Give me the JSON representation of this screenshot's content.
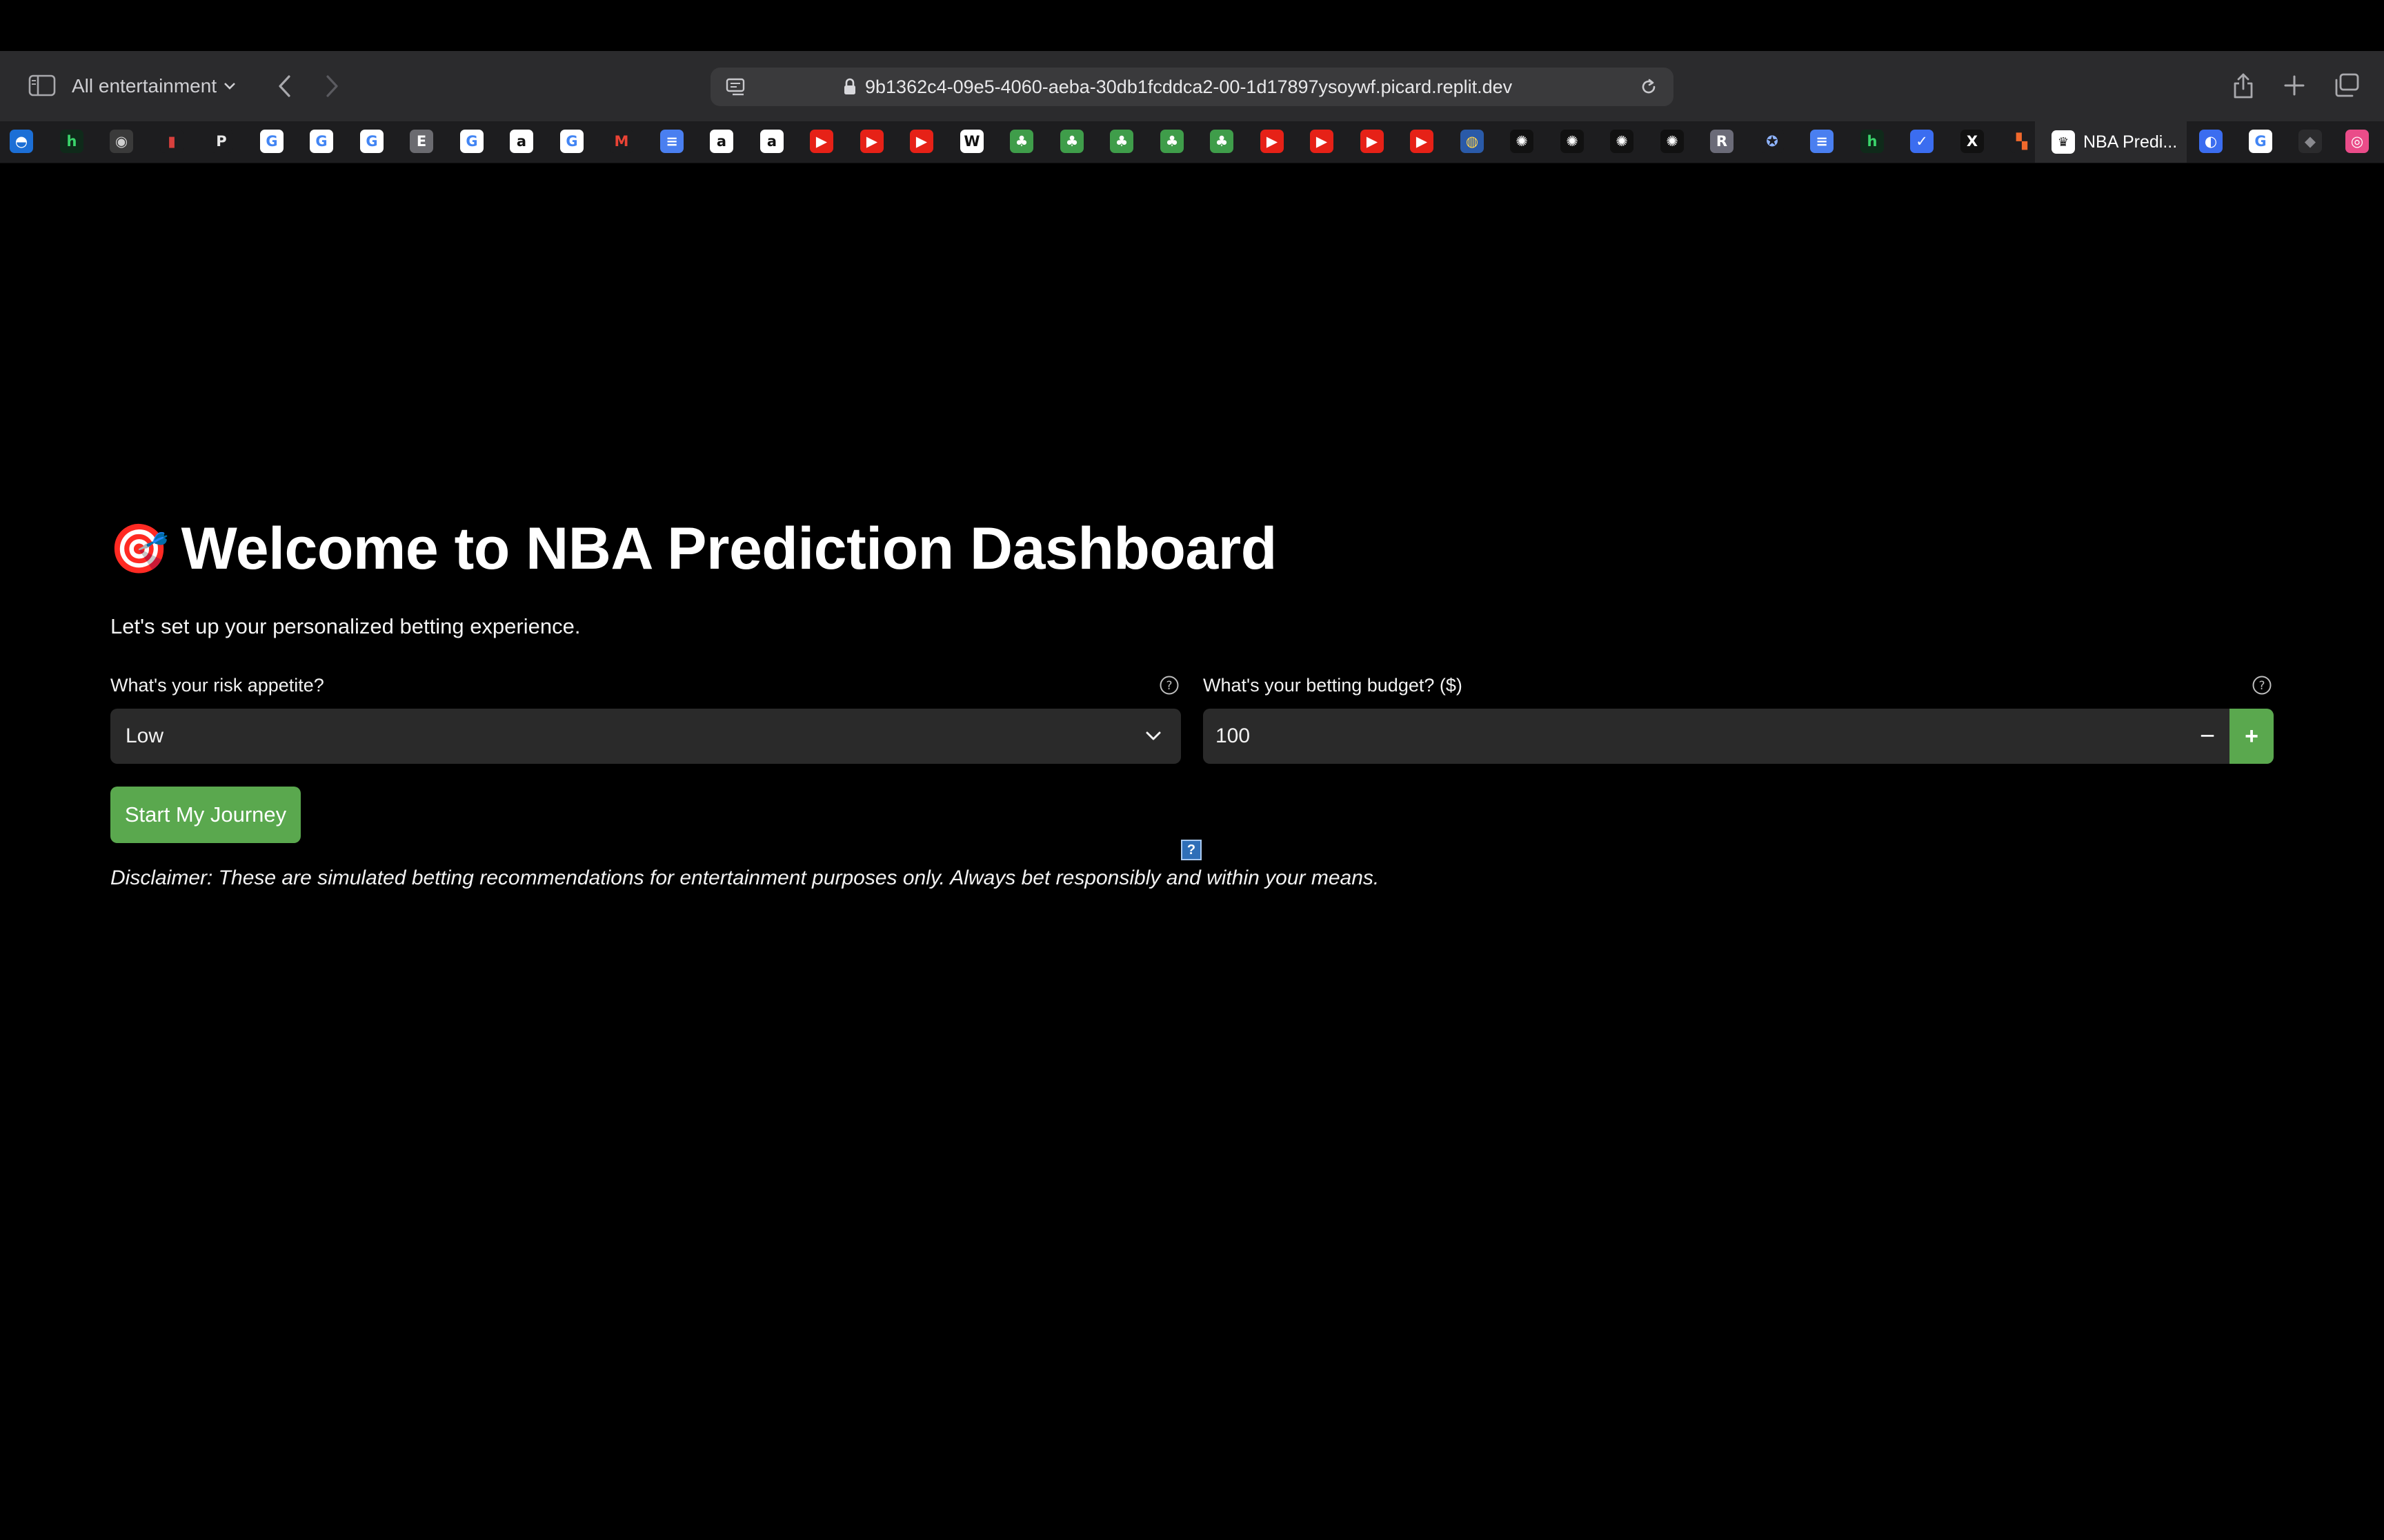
{
  "browser": {
    "tab_group_label": "All entertainment",
    "url": "9b1362c4-09e5-4060-aeba-30db1fcddca2-00-1d17897ysoywf.picard.replit.dev",
    "active_tab_title": "NBA Predi...",
    "favicons": [
      {
        "name": "app-blue-favicon",
        "glyph": "◓",
        "bg": "#1c6fd6",
        "fg": "#ffffff"
      },
      {
        "name": "h-favicon",
        "glyph": "h",
        "bg": "#0f2a1a",
        "fg": "#3ad46b"
      },
      {
        "name": "circle-logo-favicon",
        "glyph": "◉",
        "bg": "#3a3a3a",
        "fg": "#cfcfcf"
      },
      {
        "name": "nba-favicon",
        "glyph": "▮",
        "bg": "#1d1d1f",
        "fg": "#d8403d"
      },
      {
        "name": "p-favicon",
        "glyph": "P",
        "bg": "#1d1d1f",
        "fg": "#e8e8e8"
      },
      {
        "name": "google-favicon",
        "glyph": "G",
        "bg": "#ffffff",
        "fg": "#4285f4"
      },
      {
        "name": "google-favicon",
        "glyph": "G",
        "bg": "#ffffff",
        "fg": "#4285f4"
      },
      {
        "name": "google-favicon",
        "glyph": "G",
        "bg": "#ffffff",
        "fg": "#4285f4"
      },
      {
        "name": "e-favicon",
        "glyph": "E",
        "bg": "#6b6b70",
        "fg": "#ffffff"
      },
      {
        "name": "google-favicon",
        "glyph": "G",
        "bg": "#ffffff",
        "fg": "#4285f4"
      },
      {
        "name": "amazon-favicon",
        "glyph": "a",
        "bg": "#ffffff",
        "fg": "#111111"
      },
      {
        "name": "google-favicon",
        "glyph": "G",
        "bg": "#ffffff",
        "fg": "#4285f4"
      },
      {
        "name": "gmail-favicon",
        "glyph": "M",
        "bg": "#1d1d1f",
        "fg": "#ea4335"
      },
      {
        "name": "docs-favicon",
        "glyph": "≡",
        "bg": "#4a7ff0",
        "fg": "#ffffff"
      },
      {
        "name": "amazon-favicon",
        "glyph": "a",
        "bg": "#ffffff",
        "fg": "#111111"
      },
      {
        "name": "amazon-favicon",
        "glyph": "a",
        "bg": "#ffffff",
        "fg": "#111111"
      },
      {
        "name": "youtube-favicon",
        "glyph": "▶",
        "bg": "#e62117",
        "fg": "#ffffff"
      },
      {
        "name": "youtube-favicon",
        "glyph": "▶",
        "bg": "#e62117",
        "fg": "#ffffff"
      },
      {
        "name": "youtube-favicon",
        "glyph": "▶",
        "bg": "#e62117",
        "fg": "#ffffff"
      },
      {
        "name": "wikipedia-favicon",
        "glyph": "W",
        "bg": "#ffffff",
        "fg": "#111111"
      },
      {
        "name": "green-app-favicon",
        "glyph": "♣",
        "bg": "#3f9d4a",
        "fg": "#ffffff"
      },
      {
        "name": "green-app-favicon",
        "glyph": "♣",
        "bg": "#3f9d4a",
        "fg": "#ffffff"
      },
      {
        "name": "green-app-favicon",
        "glyph": "♣",
        "bg": "#3f9d4a",
        "fg": "#ffffff"
      },
      {
        "name": "green-app-favicon",
        "glyph": "♣",
        "bg": "#3f9d4a",
        "fg": "#ffffff"
      },
      {
        "name": "green-app-favicon",
        "glyph": "♣",
        "bg": "#3f9d4a",
        "fg": "#ffffff"
      },
      {
        "name": "youtube-favicon",
        "glyph": "▶",
        "bg": "#e62117",
        "fg": "#ffffff"
      },
      {
        "name": "youtube-favicon",
        "glyph": "▶",
        "bg": "#e62117",
        "fg": "#ffffff"
      },
      {
        "name": "youtube-favicon",
        "glyph": "▶",
        "bg": "#e62117",
        "fg": "#ffffff"
      },
      {
        "name": "youtube-favicon",
        "glyph": "▶",
        "bg": "#e62117",
        "fg": "#ffffff"
      },
      {
        "name": "globe-favicon",
        "glyph": "◍",
        "bg": "#2a5aa8",
        "fg": "#ffd34d"
      },
      {
        "name": "openai-favicon",
        "glyph": "✺",
        "bg": "#111111",
        "fg": "#ffffff"
      },
      {
        "name": "openai-favicon",
        "glyph": "✺",
        "bg": "#111111",
        "fg": "#ffffff"
      },
      {
        "name": "openai-favicon",
        "glyph": "✺",
        "bg": "#111111",
        "fg": "#ffffff"
      },
      {
        "name": "openai-favicon",
        "glyph": "✺",
        "bg": "#111111",
        "fg": "#ffffff"
      },
      {
        "name": "r-favicon",
        "glyph": "R",
        "bg": "#6b6b78",
        "fg": "#ffffff"
      },
      {
        "name": "shield-favicon",
        "glyph": "✪",
        "bg": "#1d1d1f",
        "fg": "#8fb4ff"
      },
      {
        "name": "docs-favicon",
        "glyph": "≡",
        "bg": "#4a7ff0",
        "fg": "#ffffff"
      },
      {
        "name": "h-favicon",
        "glyph": "h",
        "bg": "#0f2a1a",
        "fg": "#3ad46b"
      },
      {
        "name": "bird-favicon",
        "glyph": "✓",
        "bg": "#3b6df0",
        "fg": "#ffffff"
      },
      {
        "name": "x-favicon",
        "glyph": "X",
        "bg": "#111111",
        "fg": "#ffffff"
      },
      {
        "name": "orange-favicon",
        "glyph": "▚",
        "bg": "#1d1d1f",
        "fg": "#f0682c"
      }
    ],
    "trailing_favicons": [
      {
        "name": "search-blue-favicon",
        "glyph": "◐",
        "bg": "#3b6df0",
        "fg": "#ffffff"
      },
      {
        "name": "google-favicon",
        "glyph": "G",
        "bg": "#ffffff",
        "fg": "#4285f4"
      },
      {
        "name": "cube-favicon",
        "glyph": "◆",
        "bg": "#2b2b2d",
        "fg": "#8a8a8f"
      },
      {
        "name": "dribbble-favicon",
        "glyph": "◎",
        "bg": "#ea4c89",
        "fg": "#ffffff"
      }
    ]
  },
  "page": {
    "title_emoji": "🎯",
    "title": "Welcome to NBA Prediction Dashboard",
    "subtitle": "Let's set up your personalized betting experience.",
    "risk": {
      "label": "What's your risk appetite?",
      "value": "Low"
    },
    "budget": {
      "label": "What's your betting budget? ($)",
      "value": "100",
      "minus": "−",
      "plus": "+"
    },
    "start_button": "Start My Journey",
    "disclaimer": "Disclaimer: These are simulated betting recommendations for entertainment purposes only. Always bet responsibly and within your means.",
    "stray_marker": "?"
  },
  "colors": {
    "accent_green": "#5aa84e",
    "input_bg": "#2a2a2a",
    "background": "#000000"
  }
}
